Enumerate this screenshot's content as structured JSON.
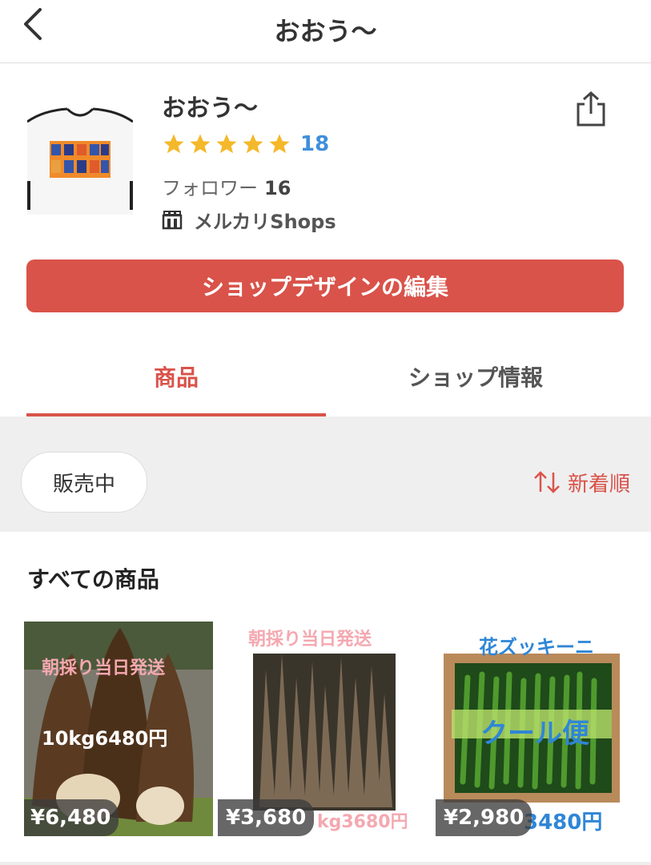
{
  "header": {
    "title": "おおう〜"
  },
  "shop": {
    "name": "おおう〜",
    "rating_stars": 5,
    "review_count": "18",
    "followers_label": "フォロワー",
    "followers_count": "16",
    "shops_label": "メルカリShops",
    "edit_button_label": "ショップデザインの編集"
  },
  "tabs": [
    {
      "label": "商品",
      "active": true
    },
    {
      "label": "ショップ情報",
      "active": false
    }
  ],
  "filter": {
    "chip_label": "販売中",
    "sort_label": "新着順"
  },
  "section_title": "すべての商品",
  "products": [
    {
      "overlay_line1": "朝採り当日発送",
      "overlay_line2": "10kg6480円",
      "price": "¥6,480"
    },
    {
      "overlay_line1": "朝採り当日発送",
      "overlay_line2": "kg3680円",
      "price": "¥3,680"
    },
    {
      "overlay_line1": "花ズッキーニ",
      "overlay_line2": "クール便",
      "overlay_line3": "3480円",
      "price": "¥2,980"
    }
  ],
  "colors": {
    "accent": "#d9534a",
    "star": "#f4b82a",
    "link_blue": "#3f8fdb"
  }
}
